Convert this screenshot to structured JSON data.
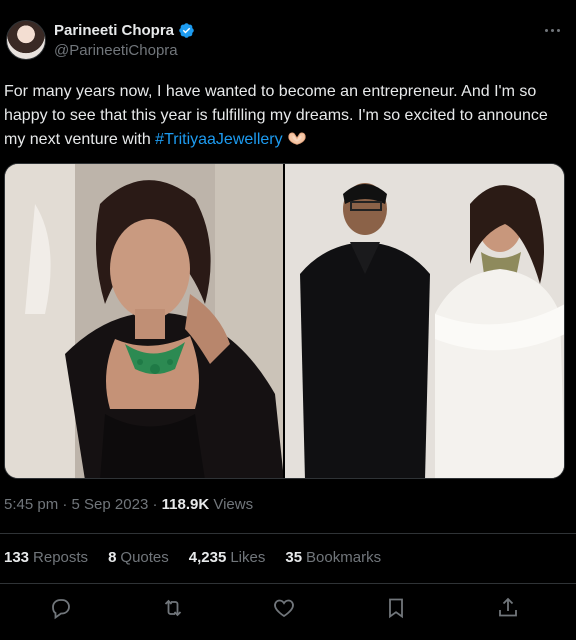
{
  "author": {
    "display_name": "Parineeti Chopra",
    "handle": "@ParineetiChopra",
    "verified": true
  },
  "tweet": {
    "text_before_hashtag": "For many years now, I have wanted to become an entrepreneur. And I'm so happy to see that this year is fulfilling my dreams. I'm so excited to announce my next venture with ",
    "hashtag": "#TritiyaaJewellery",
    "emoji": "heart-hands"
  },
  "meta": {
    "time": "5:45 pm",
    "separator": "·",
    "date": "5 Sep 2023",
    "views_count": "118.9K",
    "views_label": "Views"
  },
  "stats": {
    "reposts_count": "133",
    "reposts_label": "Reposts",
    "quotes_count": "8",
    "quotes_label": "Quotes",
    "likes_count": "4,235",
    "likes_label": "Likes",
    "bookmarks_count": "35",
    "bookmarks_label": "Bookmarks"
  },
  "colors": {
    "background": "#000000",
    "text": "#e7e9ea",
    "muted": "#71767b",
    "accent": "#1d9bf0",
    "border": "#2f3336"
  },
  "actions": [
    "reply-icon",
    "repost-icon",
    "like-icon",
    "bookmark-icon",
    "share-icon"
  ]
}
